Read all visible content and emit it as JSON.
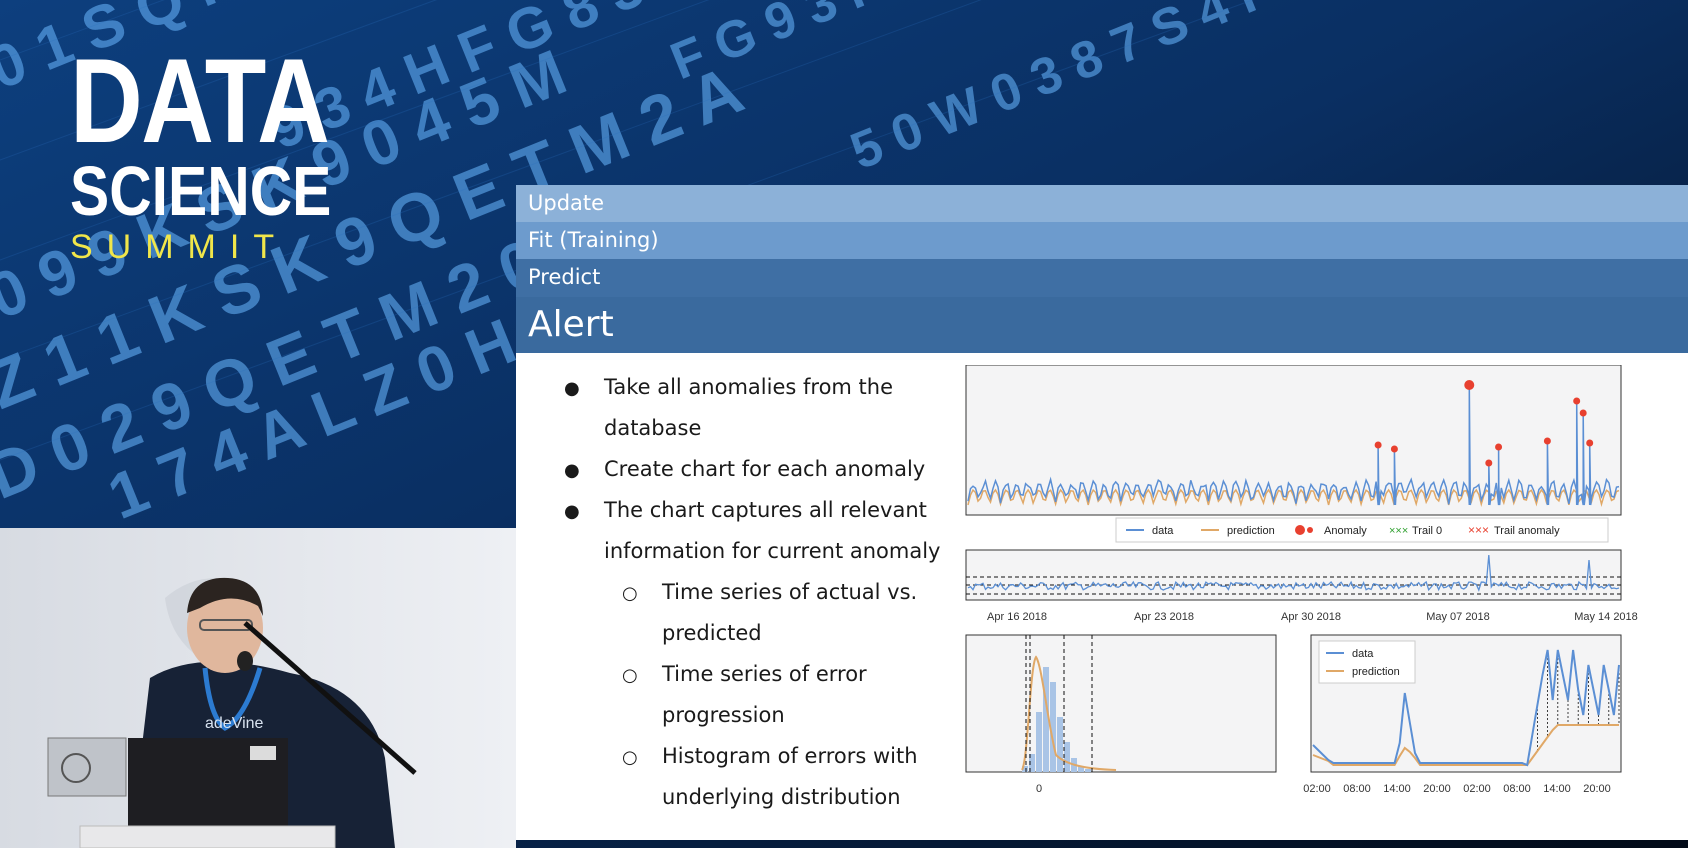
{
  "logo": {
    "line1": "DATA",
    "line2": "SCIENCE",
    "line3": "SUMMIT"
  },
  "menu": {
    "update": "Update",
    "fit": "Fit (Training)",
    "predict": "Predict",
    "alert": "Alert"
  },
  "bullets": [
    {
      "level": 1,
      "line1": "Take all anomalies from the",
      "line2": "database"
    },
    {
      "level": 1,
      "line1": "Create chart for each anomaly"
    },
    {
      "level": 1,
      "line1": "The chart captures all relevant",
      "line2": "information for current anomaly"
    },
    {
      "level": 2,
      "line1": "Time series of actual vs.",
      "line2": "predicted"
    },
    {
      "level": 2,
      "line1": "Time series of error",
      "line2": "progression"
    },
    {
      "level": 2,
      "line1": "Histogram of errors with",
      "line2": "underlying distribution"
    }
  ],
  "legend_top": [
    "data",
    "prediction",
    "Anomaly",
    "Trail 0",
    "Trail anomaly"
  ],
  "date_ticks": [
    "Apr 16 2018",
    "Apr 23 2018",
    "Apr 30 2018",
    "May 07 2018",
    "May 14 2018"
  ],
  "hist_tick": "0",
  "zoom_legend": [
    "data",
    "prediction"
  ],
  "zoom_ticks": [
    "02:00",
    "08:00",
    "14:00",
    "20:00",
    "02:00",
    "08:00",
    "14:00",
    "20:00"
  ],
  "laptop_sticker": "adeVine",
  "colors": {
    "data": "#5b8fd4",
    "prediction": "#e0a867",
    "anomaly": "#e8402f",
    "trail": "#2fa02f"
  },
  "icons": [
    "bullet-icon",
    "sub-bullet-icon"
  ]
}
